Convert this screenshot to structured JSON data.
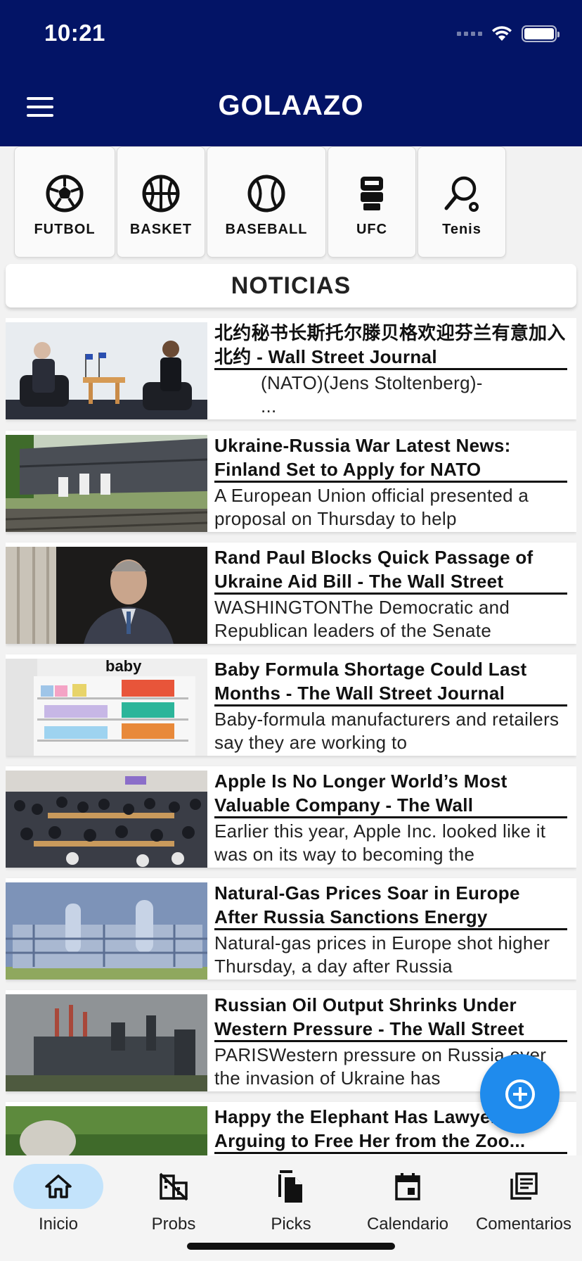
{
  "status_bar": {
    "time": "10:21"
  },
  "header": {
    "title": "GOLAAZO",
    "menu_icon": "hamburger-menu-icon"
  },
  "sports": [
    {
      "label": "FUTBOL",
      "icon": "soccer-ball-icon"
    },
    {
      "label": "BASKET",
      "icon": "basketball-icon"
    },
    {
      "label": "BASEBALL",
      "icon": "baseball-icon"
    },
    {
      "label": "UFC",
      "icon": "ufc-icon"
    },
    {
      "label": "Tenis",
      "icon": "tennis-racket-icon"
    }
  ],
  "news_section": {
    "title": "NOTICIAS"
  },
  "news": [
    {
      "title": "北约秘书长斯托尔滕贝格欢迎芬兰有意加入北约 - Wall Street Journal",
      "summary": "(NATO)(Jens Stoltenberg)-\n..."
    },
    {
      "title": "Ukraine-Russia War Latest News: Finland Set to Apply for NATO",
      "summary": "A European Union official presented a proposal on Thursday to help"
    },
    {
      "title": "Rand Paul Blocks Quick Passage of Ukraine Aid Bill - The Wall Street",
      "summary": "WASHINGTONThe Democratic and Republican leaders of the Senate"
    },
    {
      "title": "Baby Formula Shortage Could Last Months - The Wall Street Journal",
      "summary": "Baby-formula manufacturers and retailers say they are working to"
    },
    {
      "title": "Apple Is No Longer World’s Most Valuable Company - The Wall",
      "summary": "Earlier this year, Apple Inc. looked like it was on its way to becoming the"
    },
    {
      "title": "Natural-Gas Prices Soar in Europe After Russia Sanctions Energy",
      "summary": "Natural-gas prices in Europe shot higher Thursday, a day after Russia"
    },
    {
      "title": "Russian Oil Output Shrinks Under Western Pressure - The Wall Street",
      "summary": "PARISWestern pressure on Russia over the invasion of Ukraine has"
    },
    {
      "title": "Happy the Elephant Has Lawyers Arguing to Free Her from the Zoo...",
      "summary": ""
    }
  ],
  "fab": {
    "icon": "add-circle-icon"
  },
  "bottom_nav": [
    {
      "label": "Inicio",
      "icon": "home-icon",
      "active": true
    },
    {
      "label": "Probs",
      "icon": "domain-disabled-icon",
      "active": false
    },
    {
      "label": "Picks",
      "icon": "file-copy-icon",
      "active": false
    },
    {
      "label": "Calendario",
      "icon": "calendar-icon",
      "active": false
    },
    {
      "label": "Comentarios",
      "icon": "library-books-icon",
      "active": false
    }
  ],
  "colors": {
    "header_bg": "#031466",
    "fab_bg": "#1f8bed",
    "active_nav_bg": "#c3e3fb"
  }
}
